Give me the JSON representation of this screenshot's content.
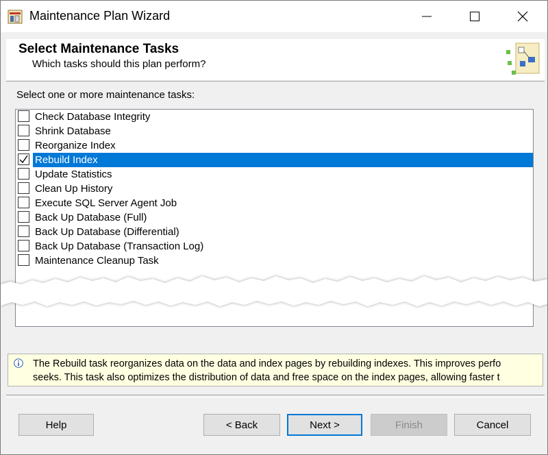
{
  "window": {
    "title": "Maintenance Plan Wizard"
  },
  "header": {
    "title": "Select Maintenance Tasks",
    "subtitle": "Which tasks should this plan perform?"
  },
  "list": {
    "label": "Select one or more maintenance tasks:",
    "items": [
      {
        "label": "Check Database Integrity",
        "checked": false,
        "selected": false
      },
      {
        "label": "Shrink Database",
        "checked": false,
        "selected": false
      },
      {
        "label": "Reorganize Index",
        "checked": false,
        "selected": false
      },
      {
        "label": "Rebuild Index",
        "checked": true,
        "selected": true
      },
      {
        "label": "Update Statistics",
        "checked": false,
        "selected": false
      },
      {
        "label": "Clean Up History",
        "checked": false,
        "selected": false
      },
      {
        "label": "Execute SQL Server Agent Job",
        "checked": false,
        "selected": false
      },
      {
        "label": "Back Up Database (Full)",
        "checked": false,
        "selected": false
      },
      {
        "label": "Back Up Database (Differential)",
        "checked": false,
        "selected": false
      },
      {
        "label": "Back Up Database (Transaction Log)",
        "checked": false,
        "selected": false
      },
      {
        "label": "Maintenance Cleanup Task",
        "checked": false,
        "selected": false
      }
    ]
  },
  "info": {
    "line1": "The Rebuild task reorganizes data on the data and index pages by rebuilding indexes. This improves perfo",
    "line2": "seeks. This task also optimizes the distribution of data and free space on the index pages, allowing faster t"
  },
  "buttons": {
    "help": "Help",
    "back": "< Back",
    "next": "Next >",
    "finish": "Finish",
    "cancel": "Cancel"
  },
  "colors": {
    "selection": "#0078d7",
    "info_bg": "#ffffe1"
  }
}
